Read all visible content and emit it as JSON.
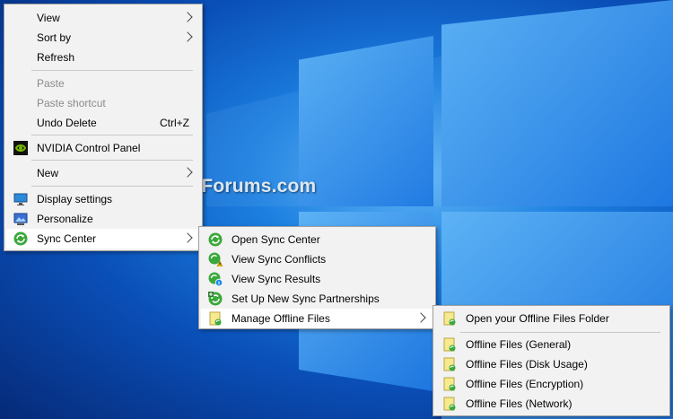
{
  "watermark": "TenForums.com",
  "context_menu": {
    "view": "View",
    "sort_by": "Sort by",
    "refresh": "Refresh",
    "paste": "Paste",
    "paste_shortcut": "Paste shortcut",
    "undo_delete": "Undo Delete",
    "undo_shortcut": "Ctrl+Z",
    "nvidia": "NVIDIA Control Panel",
    "new": "New",
    "display_settings": "Display settings",
    "personalize": "Personalize",
    "sync_center": "Sync Center"
  },
  "sync_menu": {
    "open_sync_center": "Open Sync Center",
    "view_conflicts": "View Sync Conflicts",
    "view_results": "View Sync Results",
    "new_partnerships": "Set Up New Sync Partnerships",
    "manage_offline": "Manage Offline Files"
  },
  "offline_menu": {
    "open_folder": "Open your Offline Files Folder",
    "general": "Offline Files (General)",
    "disk_usage": "Offline Files (Disk Usage)",
    "encryption": "Offline Files (Encryption)",
    "network": "Offline Files (Network)"
  },
  "colors": {
    "menu_bg": "#f2f2f2",
    "highlight": "#ffffff",
    "disabled_text": "#8b8b8b",
    "sync_green": "#3aa83a"
  }
}
